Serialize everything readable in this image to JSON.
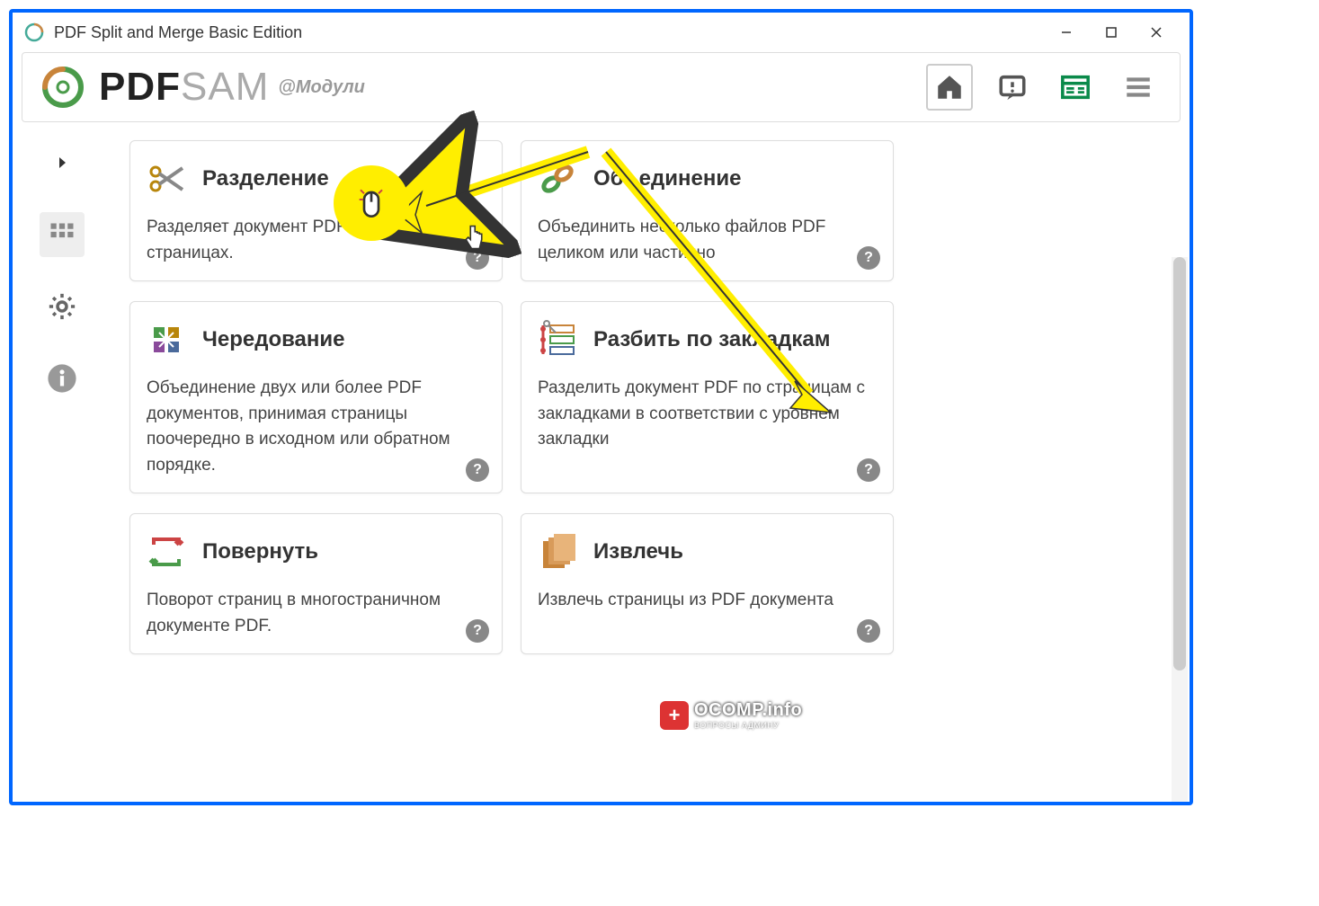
{
  "window": {
    "title": "PDF Split and Merge Basic Edition"
  },
  "header": {
    "logo_pdf": "PDF",
    "logo_sam": "SAM",
    "subtitle": "@Модули"
  },
  "cards": [
    {
      "title": "Разделение",
      "desc": "Разделяет документ PDF на указанных страницах."
    },
    {
      "title": "Объединение",
      "desc": "Объединить несколько файлов PDF целиком или частично"
    },
    {
      "title": "Чередование",
      "desc": "Объединение двух или более PDF документов, принимая страницы поочередно в исходном или обратном порядке."
    },
    {
      "title": "Разбить по закладкам",
      "desc": "Разделить документ PDF по страницам с закладками в соответствии с уровнем закладки"
    },
    {
      "title": "Повернуть",
      "desc": "Поворот страниц в многостраничном документе PDF."
    },
    {
      "title": "Извлечь",
      "desc": "Извлечь страницы из PDF документа"
    }
  ],
  "watermark": {
    "main": "OCOMP.info",
    "sub": "ВОПРОСЫ АДМИНУ"
  },
  "help_symbol": "?"
}
